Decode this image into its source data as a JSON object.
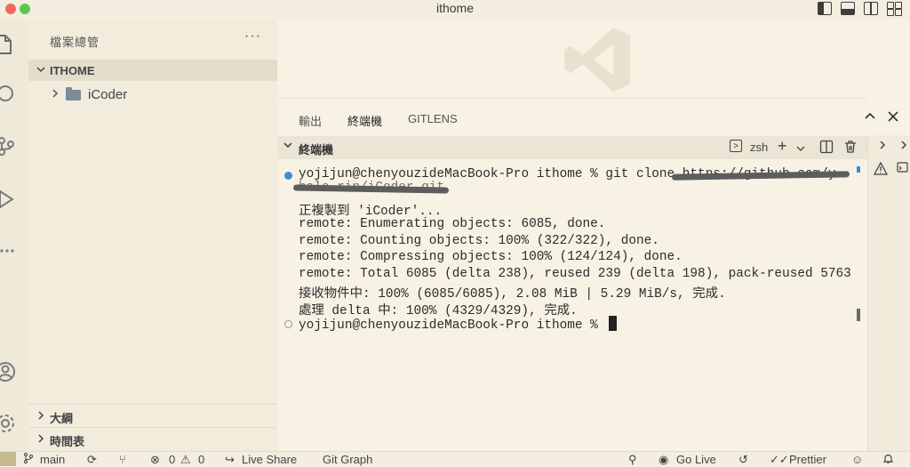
{
  "window": {
    "title": "ithome"
  },
  "sidebar": {
    "title": "檔案總管",
    "more": "···",
    "section": "ITHOME",
    "tree": [
      {
        "label": "iCoder",
        "type": "folder",
        "expanded": false
      }
    ],
    "bottom_sections": [
      "大綱",
      "時間表"
    ]
  },
  "panel": {
    "tabs": [
      "輸出",
      "終端機",
      "GITLENS"
    ],
    "active_tab": "終端機",
    "terminal_header": "終端機",
    "shell": "zsh"
  },
  "terminal": {
    "lines": [
      "yojijun@chenyouzideMacBook-Pro ithome % git clone https://github.com/y",
      "hale-rin/iCoder.git",
      "正複製到 'iCoder'...",
      "remote: Enumerating objects: 6085, done.",
      "remote: Counting objects: 100% (322/322), done.",
      "remote: Compressing objects: 100% (124/124), done.",
      "remote: Total 6085 (delta 238), reused 239 (delta 198), pack-reused 5763",
      "接收物件中: 100% (6085/6085), 2.08 MiB | 5.29 MiB/s, 完成.",
      "處理 delta 中: 100% (4329/4329), 完成.",
      "yojijun@chenyouzideMacBook-Pro ithome % "
    ]
  },
  "statusbar": {
    "branch": "main",
    "problems": "0",
    "warnings": "0",
    "liveshare": "Live Share",
    "gitgraph": "Git Graph",
    "golive": "Go Live",
    "prettier": "Prettier"
  },
  "colors": {
    "background": "#f7f2e4",
    "sidebar": "#f2ecdd",
    "section_header": "#e3ddcc",
    "prompt_dot": "#3f8bd8",
    "traffic_red": "#ee6a5f",
    "traffic_green": "#61c554"
  },
  "icons": [
    "files-icon",
    "search-icon",
    "source-control-icon",
    "run-debug-icon",
    "more-icon",
    "account-icon",
    "settings-icon",
    "vscode-logo",
    "terminal-icon",
    "plus-icon",
    "split-icon",
    "trash-icon",
    "chevron-up-icon",
    "close-icon",
    "warning-icon",
    "branch-icon",
    "sync-icon",
    "bell-icon"
  ]
}
